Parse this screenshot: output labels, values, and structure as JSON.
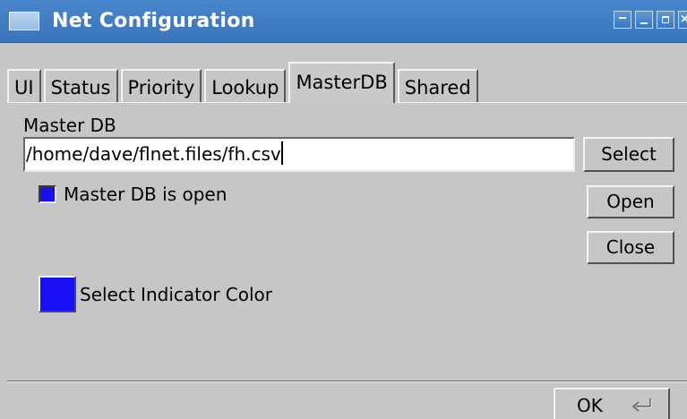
{
  "window": {
    "title": "Net Configuration"
  },
  "titlebar_buttons": [
    {
      "name": "first-button"
    },
    {
      "name": "minimize-button"
    },
    {
      "name": "maximize-button"
    },
    {
      "name": "close-button"
    }
  ],
  "tabs": [
    {
      "label": "UI",
      "active": false
    },
    {
      "label": "Status",
      "active": false
    },
    {
      "label": "Priority",
      "active": false
    },
    {
      "label": "Lookup",
      "active": false
    },
    {
      "label": "MasterDB",
      "active": true
    },
    {
      "label": "Shared",
      "active": false
    }
  ],
  "masterdb": {
    "group_label": "Master DB",
    "path_value": "/home/dave/flnet.files/fh.csv",
    "select_label": "Select",
    "open_label": "Open",
    "close_label": "Close",
    "status_label": "Master DB is open",
    "indicator_color": "#1a10ee",
    "color_button_label": "Select Indicator Color"
  },
  "footer": {
    "ok_label": "OK"
  },
  "icons": {
    "window_icon": "window-icon",
    "ok_icon": "return-icon"
  },
  "colors": {
    "titlebar": "#3a74bb",
    "background": "#c6c6c6",
    "indicator": "#1a10f5"
  }
}
